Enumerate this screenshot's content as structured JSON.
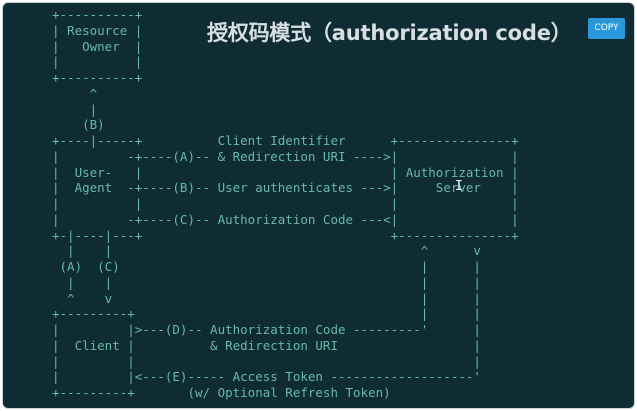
{
  "page": {
    "title": "授权码模式（authorization code）",
    "copy_label": "COPY",
    "cursor_icon": "text-cursor-icon",
    "cursor_glyph": "I"
  },
  "diagram_lines": [
    "+----------+",
    "| Resource |",
    "|   Owner  |",
    "|          |",
    "+----------+",
    "     ^",
    "     |",
    "    (B)",
    "+----|-----+          Client Identifier      +---------------+",
    "|         -+----(A)-- & Redirection URI ---->|               |",
    "|  User-   |                                 | Authorization |",
    "|  Agent  -+----(B)-- User authenticates --->|     Server    |",
    "|          |                                 |               |",
    "|         -+----(C)-- Authorization Code ---<|               |",
    "+-|----|---+                                 +---------------+",
    "  |    |                                         ^      v",
    " (A)  (C)                                        |      |",
    "  |    |                                         |      |",
    "  ^    v                                         |      |",
    "+---------+                                      |      |",
    "|         |>---(D)-- Authorization Code ---------'      |",
    "|  Client |          & Redirection URI                  |",
    "|         |                                             |",
    "|         |<---(E)----- Access Token -------------------'",
    "+---------+       (w/ Optional Refresh Token)"
  ],
  "colors": {
    "background": "#0f2b33",
    "diagram_text": "#67b8ad",
    "title_text": "#d8dfe2",
    "copy_button": "#2a98db"
  }
}
